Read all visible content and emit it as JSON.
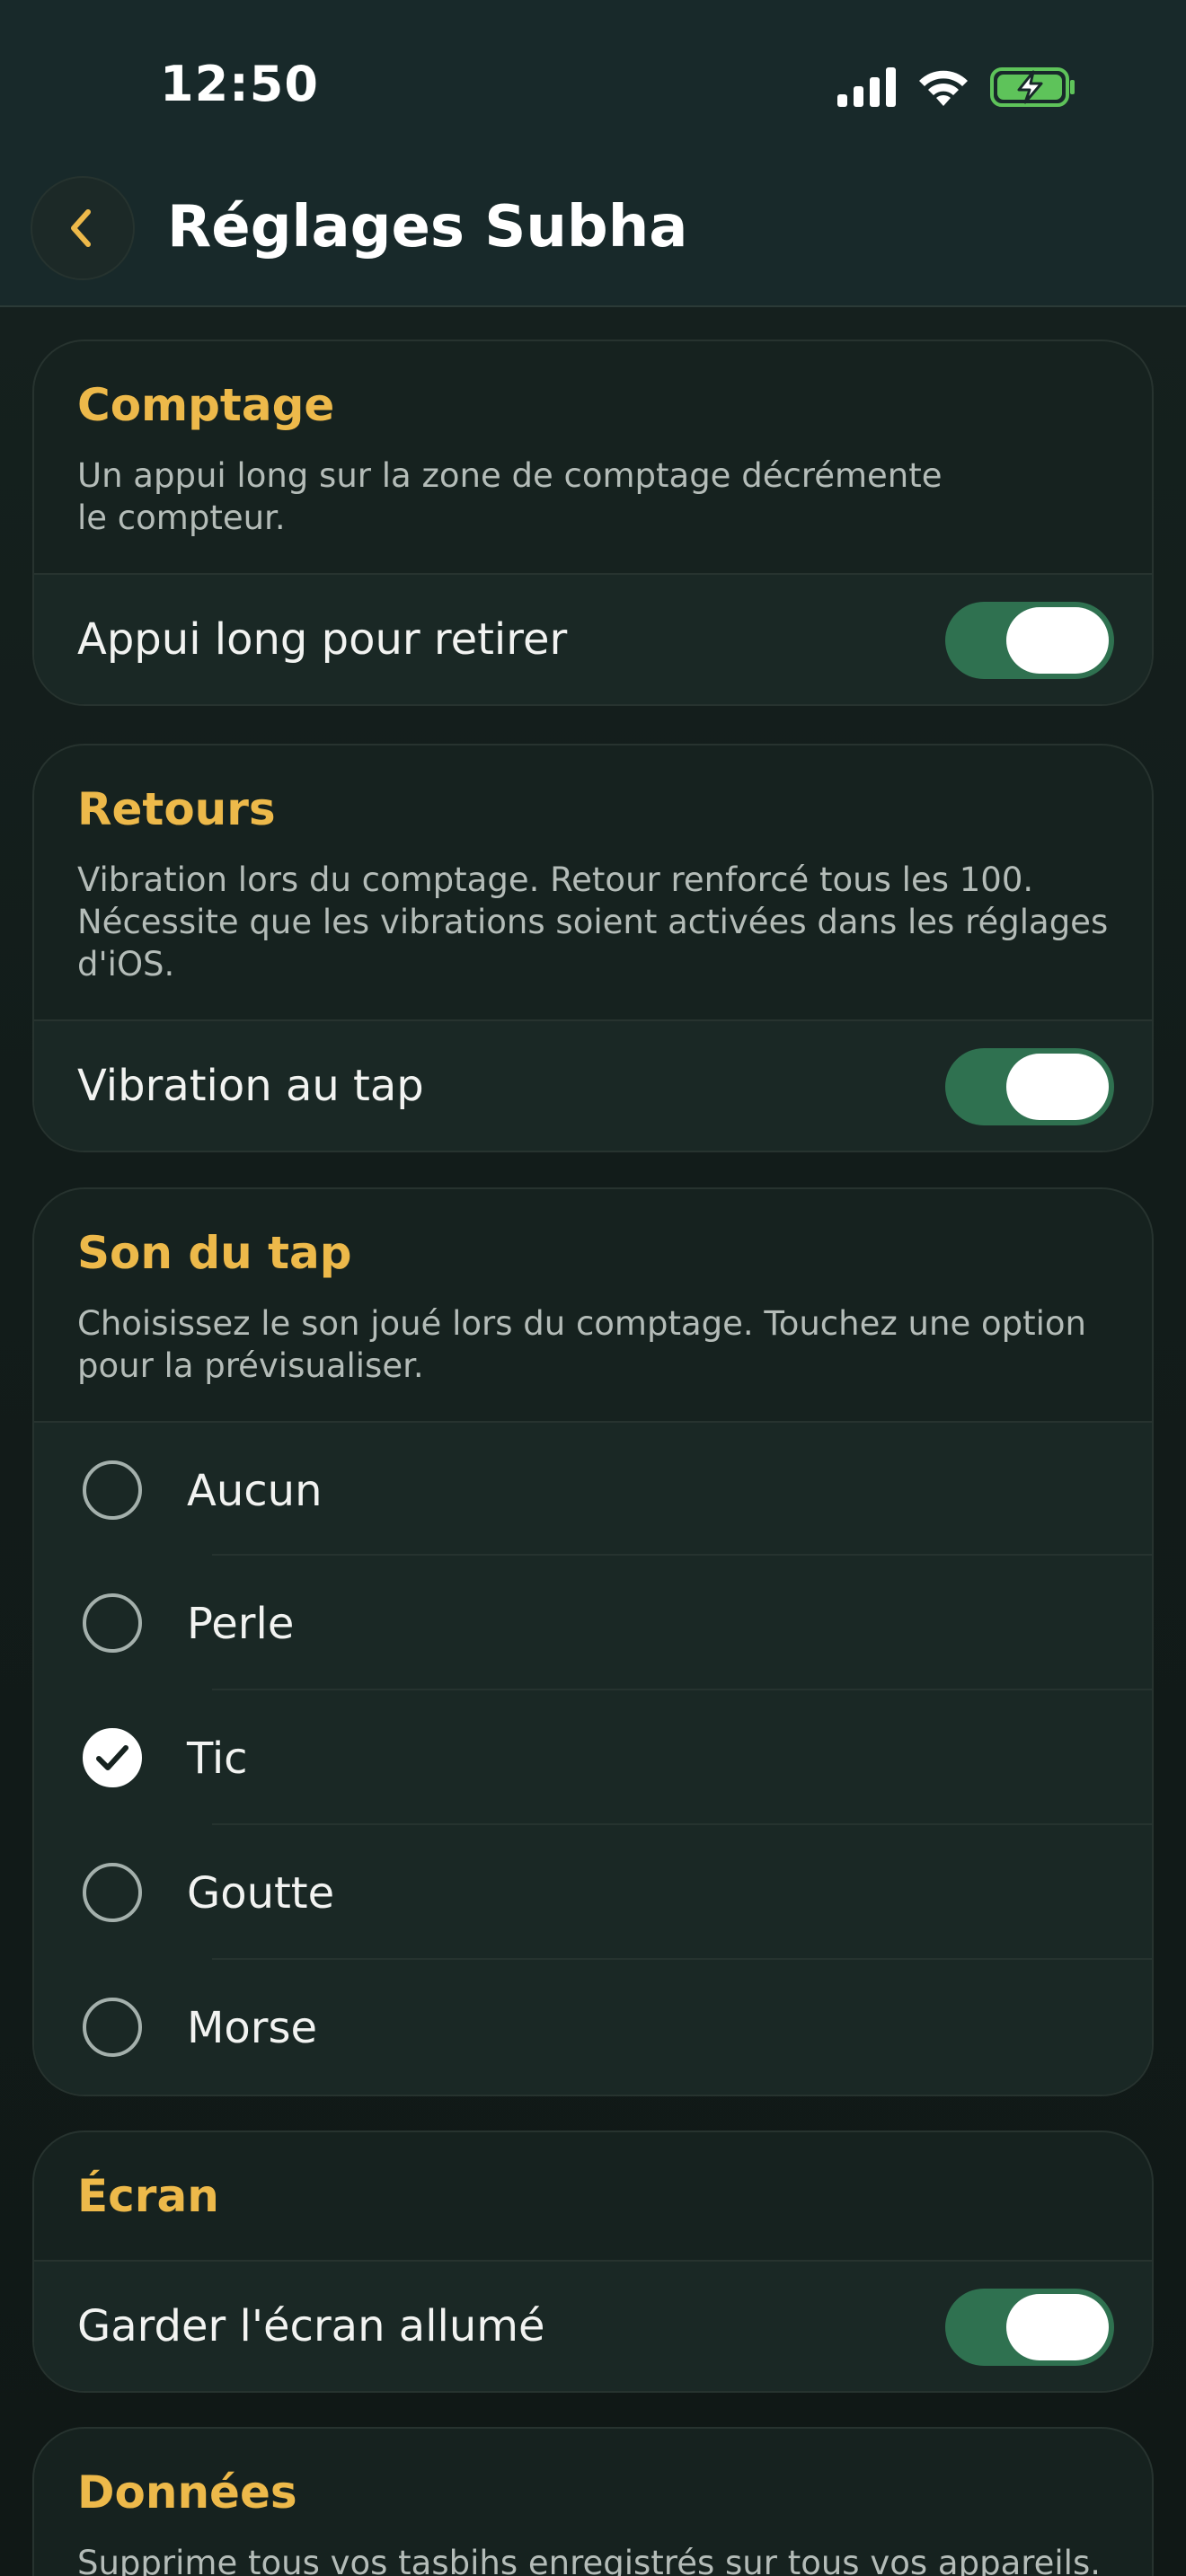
{
  "status": {
    "time": "12:50"
  },
  "nav": {
    "title": "Réglages Subha"
  },
  "counting": {
    "title": "Comptage",
    "description": "Un appui long sur la zone de comptage décrémente le compteur.",
    "toggle_label": "Appui long pour retirer",
    "toggle_on": true
  },
  "feedback": {
    "title": "Retours",
    "description": "Vibration lors du comptage. Retour renforcé tous les 100. Nécessite que les vibrations soient activées dans les réglages d'iOS.",
    "toggle_label": "Vibration au tap",
    "toggle_on": true
  },
  "tap_sound": {
    "title": "Son du tap",
    "description": "Choisissez le son joué lors du comptage. Touchez une option pour la prévisualiser.",
    "options": [
      {
        "label": "Aucun",
        "selected": false
      },
      {
        "label": "Perle",
        "selected": false
      },
      {
        "label": "Tic",
        "selected": true
      },
      {
        "label": "Goutte",
        "selected": false
      },
      {
        "label": "Morse",
        "selected": false
      }
    ]
  },
  "screen": {
    "title": "Écran",
    "toggle_label": "Garder l'écran allumé",
    "toggle_on": true
  },
  "data_section": {
    "title": "Données",
    "description": "Supprime tous vos tasbihs enregistrés sur tous vos appareils."
  },
  "colors": {
    "accent": "#edb94a",
    "toggle_on": "#2f7150",
    "battery": "#5ec35a"
  },
  "icons": {
    "back": "chevron-left-icon",
    "check": "checkmark-icon",
    "signal": "cellular-signal-icon",
    "wifi": "wifi-icon",
    "battery": "battery-charging-icon"
  }
}
